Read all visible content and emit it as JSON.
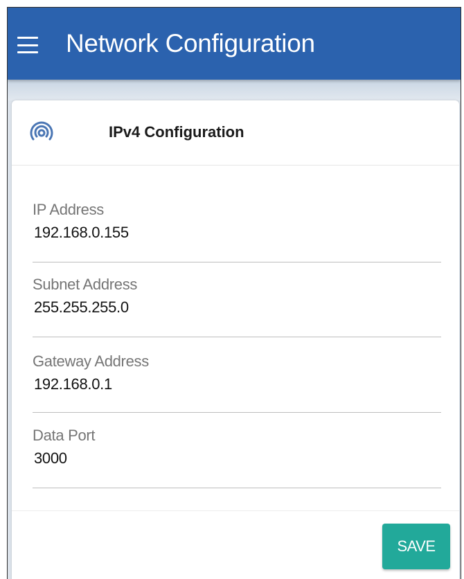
{
  "app_bar": {
    "title": "Network Configuration",
    "menu_icon": "hamburger-menu-icon",
    "color": "#2b62ae"
  },
  "card": {
    "title": "IPv4 Configuration",
    "icon": "wifi-signal-icon",
    "icon_color": "#4a76b4"
  },
  "fields": [
    {
      "label": "IP Address",
      "value": "192.168.0.155"
    },
    {
      "label": "Subnet Address",
      "value": "255.255.255.0"
    },
    {
      "label": "Gateway Address",
      "value": "192.168.0.1"
    },
    {
      "label": "Data Port",
      "value": "3000"
    }
  ],
  "footer": {
    "save_label": "SAVE",
    "save_color": "#22a99a"
  }
}
